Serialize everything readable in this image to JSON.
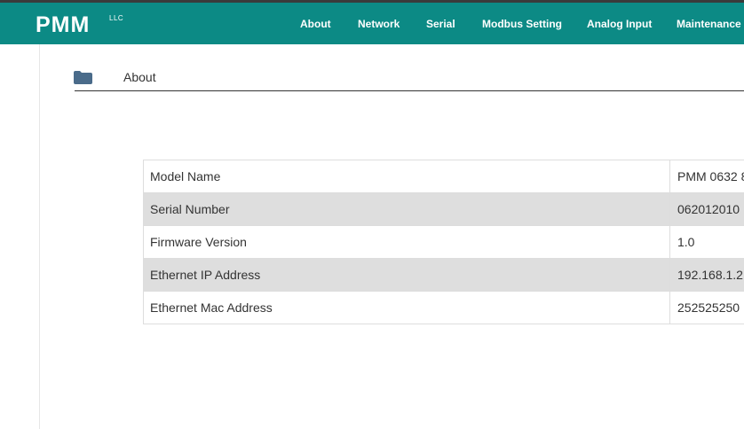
{
  "header": {
    "logo": "PMM",
    "logo_suffix": "LLC",
    "nav": [
      {
        "label": "About"
      },
      {
        "label": "Network"
      },
      {
        "label": "Serial"
      },
      {
        "label": "Modbus Setting"
      },
      {
        "label": "Analog Input"
      },
      {
        "label": "Maintenance"
      }
    ],
    "accent_color": "#0c8a85"
  },
  "breadcrumb": {
    "icon": "folder-icon",
    "label": "About"
  },
  "info_table": {
    "rows": [
      {
        "label": "Model Name",
        "value": "PMM 0632 8"
      },
      {
        "label": "Serial Number",
        "value": "062012010"
      },
      {
        "label": "Firmware Version",
        "value": "1.0"
      },
      {
        "label": "Ethernet IP Address",
        "value": "192.168.1.2"
      },
      {
        "label": "Ethernet Mac Address",
        "value": "252525250"
      }
    ],
    "alt_row_color": "#dedede"
  }
}
